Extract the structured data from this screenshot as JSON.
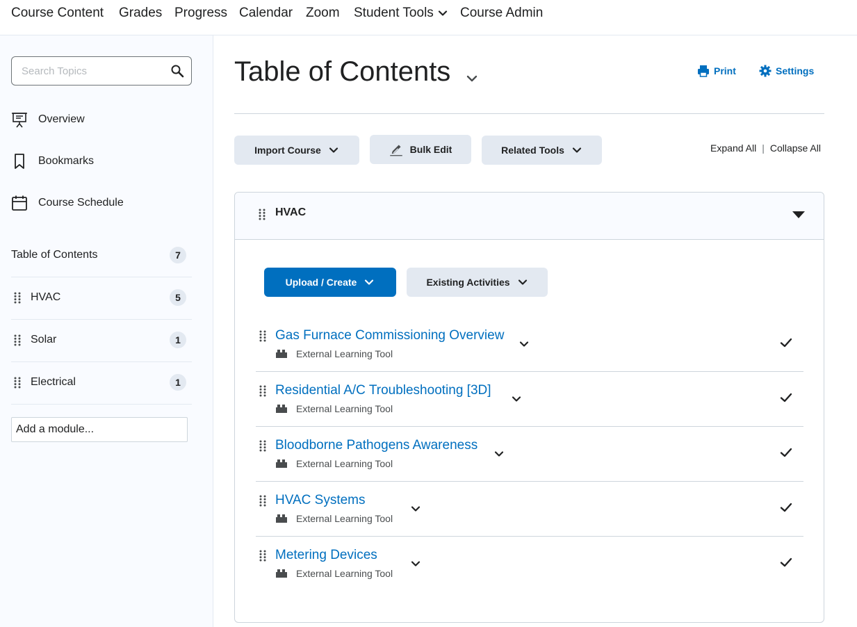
{
  "topnav": {
    "items": [
      {
        "label": "Course Content"
      },
      {
        "label": "Grades"
      },
      {
        "label": "Progress"
      },
      {
        "label": "Calendar"
      },
      {
        "label": "Zoom"
      },
      {
        "label": "Student Tools",
        "has_dropdown": true
      },
      {
        "label": "Course Admin"
      }
    ]
  },
  "sidebar": {
    "search_placeholder": "Search Topics",
    "links": [
      {
        "label": "Overview",
        "icon": "presentation-icon"
      },
      {
        "label": "Bookmarks",
        "icon": "bookmark-icon"
      },
      {
        "label": "Course Schedule",
        "icon": "calendar-icon"
      }
    ],
    "toc": {
      "label": "Table of Contents",
      "count": "7"
    },
    "modules": [
      {
        "label": "HVAC",
        "count": "5"
      },
      {
        "label": "Solar",
        "count": "1"
      },
      {
        "label": "Electrical",
        "count": "1"
      }
    ],
    "add_module_placeholder": "Add a module..."
  },
  "main": {
    "title": "Table of Contents",
    "print_label": "Print",
    "settings_label": "Settings",
    "toolbar": {
      "import_course": "Import Course",
      "bulk_edit": "Bulk Edit",
      "related_tools": "Related Tools"
    },
    "expand_all": "Expand All",
    "collapse_all": "Collapse All",
    "module": {
      "name": "HVAC",
      "upload_create": "Upload / Create",
      "existing_activities": "Existing Activities",
      "topics": [
        {
          "title": "Gas Furnace Commissioning Overview",
          "type": "External Learning Tool"
        },
        {
          "title": "Residential A/C Troubleshooting [3D]",
          "type": "External Learning Tool"
        },
        {
          "title": "Bloodborne Pathogens Awareness",
          "type": "External Learning Tool"
        },
        {
          "title": "HVAC Systems",
          "type": "External Learning Tool"
        },
        {
          "title": "Metering Devices",
          "type": "External Learning Tool"
        }
      ]
    }
  },
  "colors": {
    "accent": "#006fbf",
    "button_bg": "#e3e9f1",
    "sidebar_bg": "#f9fbff",
    "text": "#202122"
  }
}
